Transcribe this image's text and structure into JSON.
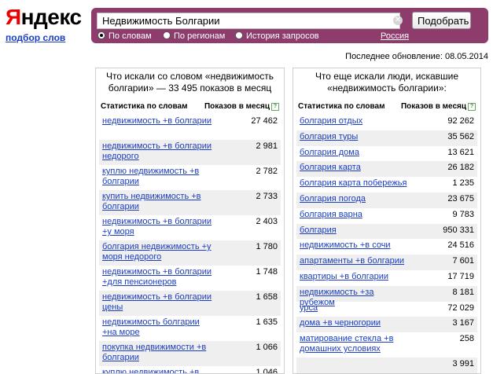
{
  "header": {
    "logo_first": "Я",
    "logo_rest": "ндекс",
    "subtitle": "подбор слов"
  },
  "search": {
    "value": "Недвижимость Болгарии",
    "button_label": "Подобрать",
    "clear_glyph": "✕",
    "radio_words": "По словам",
    "radio_regions": "По регионам",
    "radio_history": "История запросов",
    "selected_radio": "По словам",
    "region": "Россия"
  },
  "last_updated": "Последнее обновление: 08.05.2014",
  "left_panel": {
    "title": "Что искали со словом «недвижимость болгарии» — 33 495 показов в месяц",
    "col_words": "Статистика по словам",
    "col_shows": "Показов в месяц",
    "hint_glyph": "?",
    "rows": [
      {
        "phrase": "недвижимость +в болгарии",
        "count": "27 462"
      },
      {
        "phrase": "недвижимость +в болгарии недорого",
        "count": "2 981"
      },
      {
        "phrase": "куплю недвижимость +в болгарии",
        "count": "2 782"
      },
      {
        "phrase": "купить недвижимость +в болгарии",
        "count": "2 733"
      },
      {
        "phrase": "недвижимость +в болгарии +у моря",
        "count": "2 403"
      },
      {
        "phrase": "болгария недвижимость +у моря недорого",
        "count": "1 780"
      },
      {
        "phrase": "недвижимость +в болгарии +для пенсионеров",
        "count": "1 748"
      },
      {
        "phrase": "недвижимость +в болгарии цены",
        "count": "1 658"
      },
      {
        "phrase": "недвижимость болгарии +на море",
        "count": "1 635"
      },
      {
        "phrase": "покупка недвижимости +в болгарии",
        "count": "1 066"
      },
      {
        "phrase": "куплю недвижимость +в",
        "count": "1 046"
      }
    ]
  },
  "right_panel": {
    "title": "Что еще искали люди, искавшие «недвижимость болгарии»:",
    "col_words": "Статистика по словам",
    "col_shows": "Показов в месяц",
    "hint_glyph": "?",
    "rows": [
      {
        "phrase": "болгария отдых",
        "count": "92 262"
      },
      {
        "phrase": "болгария туры",
        "count": "35 562"
      },
      {
        "phrase": "болгария дома",
        "count": "13 621"
      },
      {
        "phrase": "болгария карта",
        "count": "26 182"
      },
      {
        "phrase": "болгария карта побережья",
        "count": "1 235"
      },
      {
        "phrase": "болгария погода",
        "count": "23 675"
      },
      {
        "phrase": "болгария варна",
        "count": "9 783"
      },
      {
        "phrase": "болгария",
        "count": "950 331"
      },
      {
        "phrase": "недвижимость +в сочи",
        "count": "24 516"
      },
      {
        "phrase": "апартаменты +в болгарии",
        "count": "7 601"
      },
      {
        "phrase": "квартиры +в болгарии",
        "count": "17 719"
      },
      {
        "phrase": "недвижимость +за рубежом",
        "count": "8 181"
      },
      {
        "phrase": "урса",
        "count": "72 029"
      },
      {
        "phrase": "дома +в черногории",
        "count": "3 167"
      },
      {
        "phrase": "матирование стекла +в домашних условиях",
        "count": "258"
      },
      {
        "phrase": "",
        "count": "3 991"
      }
    ]
  }
}
